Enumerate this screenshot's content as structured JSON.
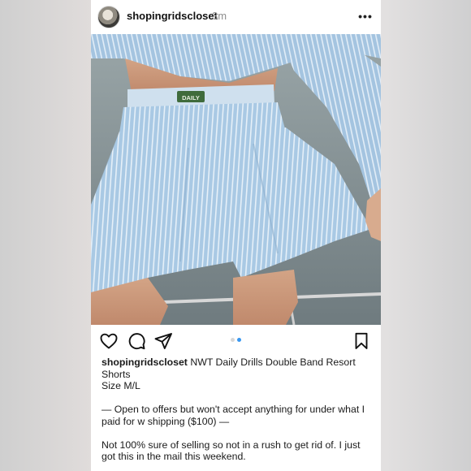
{
  "post": {
    "username": "shopingridscloset",
    "time_ago": "3m",
    "more_icon": "more-horizontal-icon",
    "photo": {
      "band_label": "DAILY"
    },
    "carousel": {
      "current_index": 2,
      "total": 2,
      "active_color": "#3897f0"
    },
    "actions": [
      "heart-icon",
      "comment-icon",
      "send-icon",
      "bookmark-icon"
    ],
    "caption": {
      "username": "shopingridscloset",
      "title": "NWT Daily Drills Double Band Resort Shorts",
      "size": "Size M/L",
      "offer_line": "— Open to offers but won't accept anything for under what I paid for w shipping ($100) —",
      "note_line": "Not 100% sure of selling so not in a rush to get rid of. I just got this in the mail this weekend."
    }
  }
}
